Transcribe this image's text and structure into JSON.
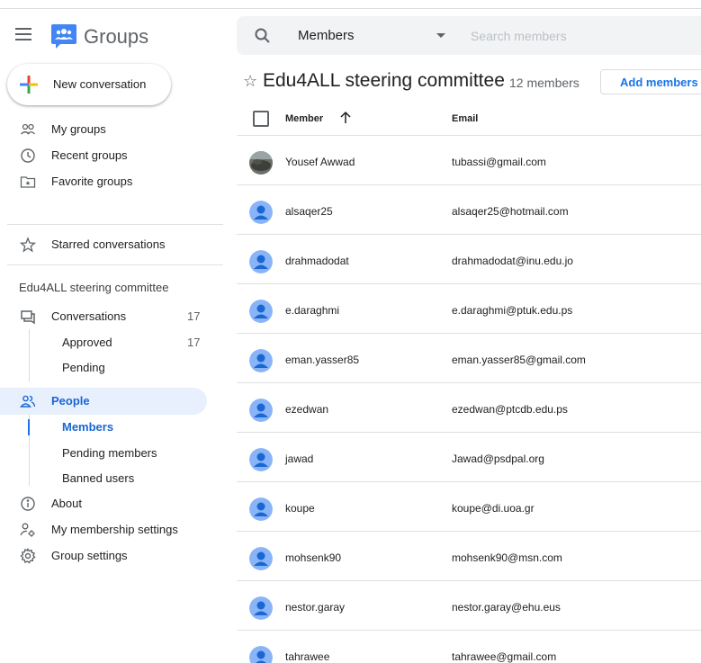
{
  "app": {
    "title": "Groups"
  },
  "sidebar": {
    "new_conversation": "New conversation",
    "items_top": [
      {
        "label": "My groups",
        "icon": "my-groups-icon"
      },
      {
        "label": "Recent groups",
        "icon": "clock-icon"
      },
      {
        "label": "Favorite groups",
        "icon": "star-folder-icon"
      }
    ],
    "starred": "Starred conversations",
    "group_section_title": "Edu4ALL steering committee",
    "conversations": {
      "label": "Conversations",
      "count": "17"
    },
    "approved": {
      "label": "Approved",
      "count": "17"
    },
    "pending": "Pending",
    "people": "People",
    "members": "Members",
    "pending_members": "Pending members",
    "banned_users": "Banned users",
    "about": "About",
    "membership_settings": "My membership settings",
    "group_settings": "Group settings"
  },
  "search": {
    "scope": "Members",
    "placeholder": "Search members"
  },
  "header": {
    "group_title": "Edu4ALL steering committee",
    "member_count": "12 members",
    "add_members": "Add members"
  },
  "table": {
    "col_member": "Member",
    "col_email": "Email",
    "rows": [
      {
        "name": "Yousef Awwad",
        "email": "tubassi@gmail.com",
        "avatar": "photo"
      },
      {
        "name": "alsaqer25",
        "email": "alsaqer25@hotmail.com",
        "avatar": "default"
      },
      {
        "name": "drahmadodat",
        "email": "drahmadodat@inu.edu.jo",
        "avatar": "default"
      },
      {
        "name": "e.daraghmi",
        "email": "e.daraghmi@ptuk.edu.ps",
        "avatar": "default"
      },
      {
        "name": "eman.yasser85",
        "email": "eman.yasser85@gmail.com",
        "avatar": "default"
      },
      {
        "name": "ezedwan",
        "email": "ezedwan@ptcdb.edu.ps",
        "avatar": "default"
      },
      {
        "name": "jawad",
        "email": "Jawad@psdpal.org",
        "avatar": "default"
      },
      {
        "name": "koupe",
        "email": "koupe@di.uoa.gr",
        "avatar": "default"
      },
      {
        "name": "mohsenk90",
        "email": "mohsenk90@msn.com",
        "avatar": "default"
      },
      {
        "name": "nestor.garay",
        "email": "nestor.garay@ehu.eus",
        "avatar": "default"
      },
      {
        "name": "tahrawee",
        "email": "tahrawee@gmail.com",
        "avatar": "default"
      }
    ]
  },
  "colors": {
    "accent": "#1a73e8",
    "active_bg": "#e8f0fe",
    "avatar_blue": "#8ab4f8"
  }
}
